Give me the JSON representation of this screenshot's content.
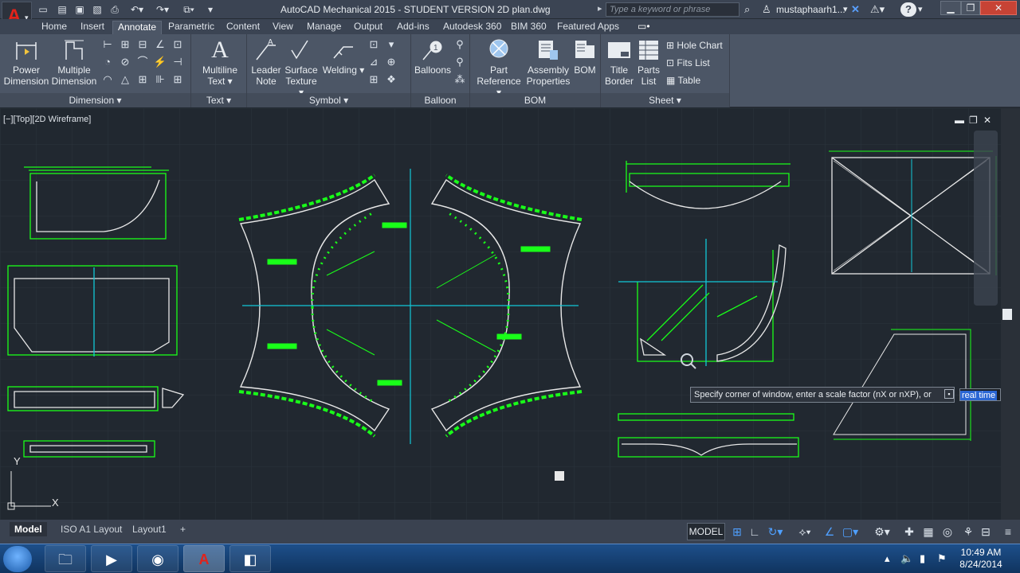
{
  "window": {
    "title": "AutoCAD Mechanical 2015 - STUDENT VERSION    2D plan.dwg",
    "search_placeholder": "Type a keyword or phrase",
    "user": "mustaphaarh1...",
    "help": "?"
  },
  "tabs": [
    "Home",
    "Insert",
    "Annotate",
    "Parametric",
    "Content",
    "View",
    "Manage",
    "Output",
    "Add-ins",
    "Autodesk 360",
    "BIM 360",
    "Featured Apps"
  ],
  "active_tab": "Annotate",
  "ribbon": {
    "dimension_panel": {
      "power_dimension": [
        "Power",
        "Dimension"
      ],
      "multiple_dimension": [
        "Multiple",
        "Dimension"
      ],
      "footer": "Dimension"
    },
    "text_panel": {
      "multiline_text": [
        "Multiline",
        "Text"
      ],
      "footer": "Text"
    },
    "symbol_panel": {
      "leader_note": [
        "Leader",
        "Note"
      ],
      "surface_texture": [
        "Surface",
        "Texture"
      ],
      "welding": "Welding",
      "footer": "Symbol"
    },
    "balloon_panel": {
      "balloons": "Balloons",
      "footer": "Balloon"
    },
    "bom_panel": {
      "part_reference": [
        "Part",
        "Reference"
      ],
      "assembly_properties": [
        "Assembly",
        "Properties"
      ],
      "bom": "BOM",
      "footer": "BOM"
    },
    "sheet_panel": {
      "title_border": [
        "Title",
        "Border"
      ],
      "parts_list": [
        "Parts",
        "List"
      ],
      "hole_chart": "Hole Chart",
      "fits_list": "Fits List",
      "table": "Table",
      "footer": "Sheet"
    }
  },
  "viewport": {
    "label": "[−][Top][2D Wireframe]",
    "axis_y": "Y",
    "axis_x": "X",
    "tooltip": "Specify corner of window, enter a scale factor (nX or nXP), or",
    "input_value": "real time"
  },
  "layout_tabs": [
    "Model",
    "ISO A1 Layout",
    "Layout1"
  ],
  "active_layout": "Model",
  "status": {
    "model": "MODEL"
  },
  "clock": {
    "time": "10:49 AM",
    "date": "8/24/2014"
  },
  "colors": {
    "geometry": "#19ff19",
    "centerline": "#12c8d8",
    "outline": "#e8e8e8",
    "background": "#212830"
  }
}
